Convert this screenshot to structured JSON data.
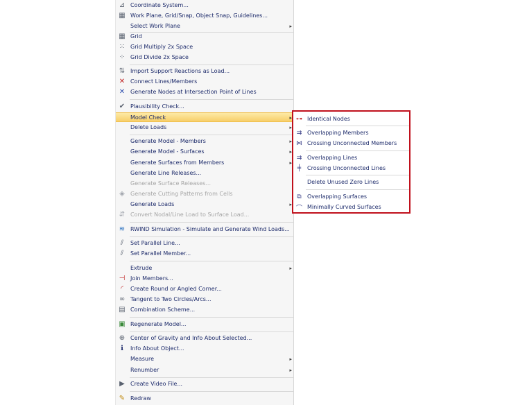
{
  "menu": {
    "items": [
      {
        "label": "Coordinate System...",
        "icon": "coordinate-system-icon",
        "glyph": "⊿"
      },
      {
        "label": "Work Plane, Grid/Snap, Object Snap, Guidelines...",
        "icon": "work-plane-icon",
        "glyph": "▦"
      },
      {
        "label": "Select Work Plane",
        "arrow": "▸"
      },
      {
        "label": "Grid",
        "icon": "grid-icon",
        "glyph": "▦"
      },
      {
        "label": "Grid Multiply 2x Space",
        "icon": "grid-multiply-icon",
        "glyph": "⁙"
      },
      {
        "label": "Grid Divide 2x Space",
        "icon": "grid-divide-icon",
        "glyph": "⁘"
      },
      {
        "label": "Import Support Reactions as Load...",
        "icon": "import-reactions-icon",
        "glyph": "⇅"
      },
      {
        "label": "Connect Lines/Members",
        "icon": "connect-lines-icon",
        "glyph": "✕"
      },
      {
        "label": "Generate Nodes at Intersection Point of Lines",
        "icon": "intersection-nodes-icon",
        "glyph": "✕"
      },
      {
        "label": "Plausibility Check...",
        "icon": "plausibility-check-icon",
        "glyph": "✔"
      },
      {
        "label": "Model Check",
        "arrow": "▸"
      },
      {
        "label": "Delete Loads",
        "arrow": "▸"
      },
      {
        "label": "Generate Model - Members",
        "arrow": "▸"
      },
      {
        "label": "Generate Model - Surfaces",
        "arrow": "▸"
      },
      {
        "label": "Generate Surfaces from Members",
        "arrow": "▸"
      },
      {
        "label": "Generate Line Releases..."
      },
      {
        "label": "Generate Surface Releases..."
      },
      {
        "label": "Generate Cutting Patterns from Cells",
        "icon": "cutting-patterns-icon",
        "glyph": "◈"
      },
      {
        "label": "Generate Loads",
        "arrow": "▸"
      },
      {
        "label": "Convert Nodal/Line Load to Surface Load...",
        "icon": "convert-load-icon",
        "glyph": "⇵"
      },
      {
        "label": "RWIND Simulation - Simulate and Generate Wind Loads...",
        "icon": "rwind-icon",
        "glyph": "≋"
      },
      {
        "label": "Set Parallel Line...",
        "icon": "parallel-line-icon",
        "glyph": "⫽"
      },
      {
        "label": "Set Parallel Member...",
        "icon": "parallel-member-icon",
        "glyph": "⫽"
      },
      {
        "label": "Extrude",
        "arrow": "▸"
      },
      {
        "label": "Join Members...",
        "icon": "join-members-icon",
        "glyph": "⊣"
      },
      {
        "label": "Create Round or Angled Corner...",
        "icon": "round-corner-icon",
        "glyph": "◜"
      },
      {
        "label": "Tangent to Two Circles/Arcs...",
        "icon": "tangent-icon",
        "glyph": "∞"
      },
      {
        "label": "Combination Scheme...",
        "icon": "combination-scheme-icon",
        "glyph": "▤"
      },
      {
        "label": "Regenerate Model...",
        "icon": "regenerate-model-icon",
        "glyph": "▣"
      },
      {
        "label": "Center of Gravity and Info About Selected...",
        "icon": "center-gravity-icon",
        "glyph": "⊕"
      },
      {
        "label": "Info About Object...",
        "icon": "info-icon",
        "glyph": "ℹ"
      },
      {
        "label": "Measure",
        "arrow": "▸"
      },
      {
        "label": "Renumber",
        "arrow": "▸"
      },
      {
        "label": "Create Video File...",
        "icon": "video-file-icon",
        "glyph": "▶"
      },
      {
        "label": "Redraw",
        "icon": "redraw-icon",
        "glyph": "✎"
      }
    ]
  },
  "submenu": {
    "items": [
      {
        "label": "Identical Nodes",
        "icon": "identical-nodes-icon",
        "glyph": "⊶"
      },
      {
        "label": "Overlapping Members",
        "icon": "overlapping-members-icon",
        "glyph": "⇉"
      },
      {
        "label": "Crossing Unconnected Members",
        "icon": "crossing-members-icon",
        "glyph": "⋈"
      },
      {
        "label": "Overlapping Lines",
        "icon": "overlapping-lines-icon",
        "glyph": "⇉"
      },
      {
        "label": "Crossing Unconnected Lines",
        "icon": "crossing-lines-icon",
        "glyph": "╪"
      },
      {
        "label": "Delete Unused Zero Lines"
      },
      {
        "label": "Overlapping Surfaces",
        "icon": "overlapping-surfaces-icon",
        "glyph": "⧉"
      },
      {
        "label": "Minimally Curved Surfaces",
        "icon": "curved-surfaces-icon",
        "glyph": "⌒"
      }
    ]
  },
  "colors": {
    "highlight": "#f7cf6a",
    "frame": "#c0101c",
    "text": "#1c2a6a",
    "disabled": "#a6a6a6"
  }
}
